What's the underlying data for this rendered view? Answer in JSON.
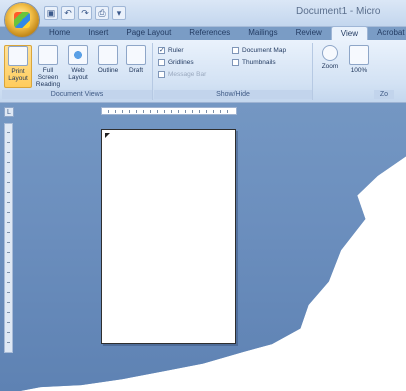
{
  "title_bar": {
    "document_title": "Document1 - Micro",
    "quick_access": [
      {
        "icon": "save-icon",
        "glyph": "▣"
      },
      {
        "icon": "undo-icon",
        "glyph": "↶"
      },
      {
        "icon": "redo-icon",
        "glyph": "↷"
      },
      {
        "icon": "print-icon",
        "glyph": "⎙"
      },
      {
        "icon": "customize-icon",
        "glyph": "▾"
      }
    ]
  },
  "tabs": [
    {
      "label": "Home"
    },
    {
      "label": "Insert"
    },
    {
      "label": "Page Layout"
    },
    {
      "label": "References"
    },
    {
      "label": "Mailings"
    },
    {
      "label": "Review"
    },
    {
      "label": "View",
      "active": true
    },
    {
      "label": "Acrobat"
    }
  ],
  "ribbon": {
    "document_views": {
      "label": "Document Views",
      "buttons": [
        {
          "label": "Print Layout",
          "selected": true
        },
        {
          "label": "Full Screen Reading"
        },
        {
          "label": "Web Layout"
        },
        {
          "label": "Outline"
        },
        {
          "label": "Draft"
        }
      ]
    },
    "show_hide": {
      "label": "Show/Hide",
      "options": [
        {
          "label": "Ruler",
          "checked": true
        },
        {
          "label": "Gridlines",
          "checked": false
        },
        {
          "label": "Message Bar",
          "checked": false,
          "disabled": true
        },
        {
          "label": "Document Map",
          "checked": false
        },
        {
          "label": "Thumbnails",
          "checked": false
        }
      ]
    },
    "zoom": {
      "label": "Zo",
      "buttons": [
        {
          "label": "Zoom"
        },
        {
          "label": "100%"
        }
      ]
    }
  },
  "workspace": {
    "ruler_corner_glyph": "L"
  },
  "colors": {
    "accent_selected": "#ffcc5c",
    "workspace_blue": "#6c8fbe",
    "ribbon_light": "#eaf2fc"
  }
}
